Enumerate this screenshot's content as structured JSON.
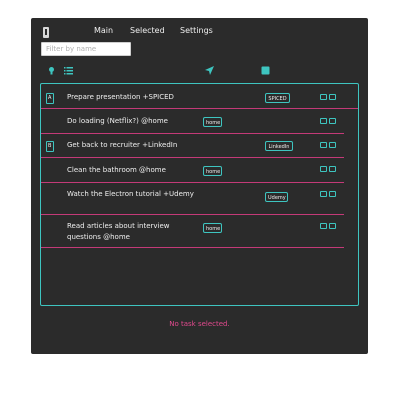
{
  "nav": {
    "main": "Main",
    "selected": "Selected",
    "settings": "Settings"
  },
  "search": {
    "placeholder": "Filter by name",
    "value": ""
  },
  "tasks": [
    {
      "text": "Prepare presentation +SPICED",
      "tag": "SPICED",
      "flag": "A"
    },
    {
      "text": "Do loading (Netflix?) @home",
      "tag": "home"
    },
    {
      "text": "Get back to recruiter +LinkedIn",
      "tag": "LinkedIn",
      "flag": "B"
    },
    {
      "text": "Clean the bathroom @home",
      "tag": "home"
    },
    {
      "text": "Watch the Electron tutorial +Udemy",
      "tag": "Udemy"
    },
    {
      "text": "Read articles about interview questions @home",
      "tag": "home"
    }
  ],
  "status": {
    "empty_selection": "No task selected."
  },
  "colors": {
    "accent": "#3ec5c0",
    "divider": "#c43a78",
    "status": "#e24a8e",
    "background": "#2b2b2b"
  },
  "icons": [
    "app-logo-icon",
    "lightbulb-icon",
    "list-icon",
    "send-icon",
    "archive-icon",
    "edit-icon",
    "delete-icon"
  ]
}
